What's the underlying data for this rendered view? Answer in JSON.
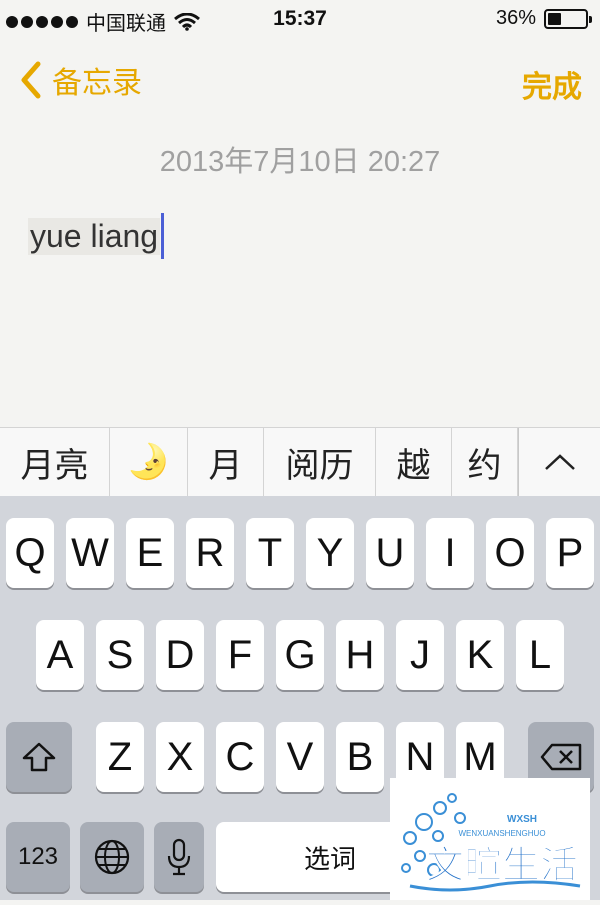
{
  "status": {
    "carrier": "中国联通",
    "time": "15:37",
    "battery": "36%",
    "battery_level": 0.36
  },
  "nav": {
    "back_label": "备忘录",
    "done_label": "完成"
  },
  "note": {
    "date": "2013年7月10日 20:27",
    "text": "yue liang"
  },
  "candidates": [
    "月亮",
    "🌛",
    "月",
    "阅历",
    "越",
    "约"
  ],
  "keyboard": {
    "row1": [
      "Q",
      "W",
      "E",
      "R",
      "T",
      "Y",
      "U",
      "I",
      "O",
      "P"
    ],
    "row2": [
      "A",
      "S",
      "D",
      "F",
      "G",
      "H",
      "J",
      "K",
      "L"
    ],
    "row3": [
      "Z",
      "X",
      "C",
      "V",
      "B",
      "N",
      "M"
    ],
    "numbers_label": "123",
    "space_label": "选词"
  },
  "watermark": {
    "title": "文暄生活",
    "subtitle": "WENXUANSHENGHUO",
    "badge": "WXSH"
  },
  "colors": {
    "accent": "#e6a800",
    "cursor": "#4b5fd6"
  }
}
